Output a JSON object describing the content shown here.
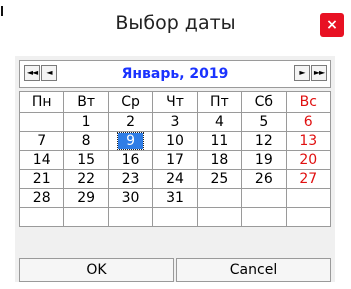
{
  "window": {
    "title": "Выбор даты",
    "close_glyph": "×"
  },
  "nav": {
    "prev_year_glyph": "◄◄",
    "prev_month_glyph": "◄",
    "next_month_glyph": "►",
    "next_year_glyph": "►►",
    "month_label": "Январь, 2019"
  },
  "calendar": {
    "weekdays": [
      "Пн",
      "Вт",
      "Ср",
      "Чт",
      "Пт",
      "Сб",
      "Вс"
    ],
    "weeks": [
      [
        "",
        "1",
        "2",
        "3",
        "4",
        "5",
        "6"
      ],
      [
        "7",
        "8",
        "9",
        "10",
        "11",
        "12",
        "13"
      ],
      [
        "14",
        "15",
        "16",
        "17",
        "18",
        "19",
        "20"
      ],
      [
        "21",
        "22",
        "23",
        "24",
        "25",
        "26",
        "27"
      ],
      [
        "28",
        "29",
        "30",
        "31",
        "",
        "",
        ""
      ],
      [
        "",
        "",
        "",
        "",
        "",
        "",
        ""
      ]
    ],
    "selected_day": "9",
    "sunday_color": "#e01010",
    "selected_color": "#2f7de6"
  },
  "buttons": {
    "ok": "OK",
    "cancel": "Cancel"
  }
}
